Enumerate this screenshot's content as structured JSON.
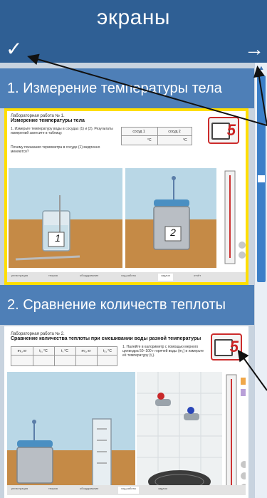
{
  "header": {
    "title": "экраны",
    "check_icon": "✓",
    "next_icon": "→"
  },
  "sections": [
    {
      "title": "1. Измерение температуры тела",
      "thumb": {
        "lab_label": "Лабораторная работа № 1.",
        "lab_name": "Измерение температуры тела",
        "task": "1. Измерьте температуру воды в сосудах (1) и (2). Результаты измерений занесите в таблицу.",
        "question": "Почему показания термометра в сосуде (1) медленно меняются?",
        "col1": "сосуд 1",
        "col2": "сосуд 2",
        "unit": "°C",
        "book_number": "5",
        "beaker1": "1",
        "beaker2": "2",
        "tabs": [
          "регистрация",
          "теория",
          "оборудование",
          "ход работы",
          "задачи",
          "отчёт"
        ]
      }
    },
    {
      "title": "2. Сравнение количеств теплоты",
      "thumb": {
        "lab_label": "Лабораторная работа № 2.",
        "lab_name": "Сравнение количества теплоты при смешивании воды разной температуры",
        "cols": [
          "m₁, кг",
          "t₁, °C",
          "t, °C",
          "m₂, кг",
          "t₂, °C"
        ],
        "task": "1. Налейте в калориметр с помощью мерного цилиндра 50–100 г горячей воды (m₁) и измерьте её температуру (t₁).",
        "book_number": "5",
        "tabs": [
          "регистрация",
          "теория",
          "оборудование",
          "ход работы",
          "задачи"
        ]
      }
    }
  ],
  "colors": {
    "header": "#2f5f94",
    "section": "#4e7fb7",
    "highlight": "#ffde00",
    "list_bg": "#c8d3df"
  }
}
